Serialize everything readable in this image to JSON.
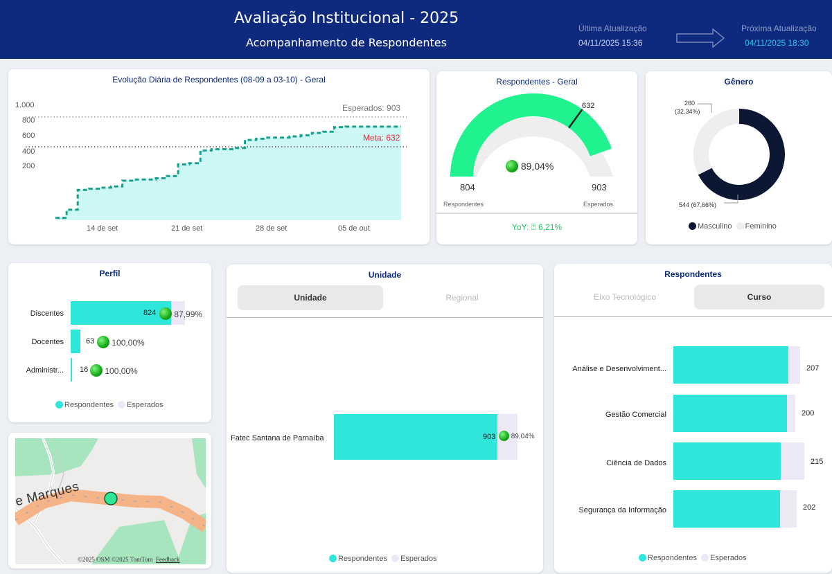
{
  "header": {
    "title": "Avaliação Institucional - 2025",
    "subtitle": "Acompanhamento de Respondentes",
    "last_update_label": "Última Atualização",
    "last_update_value": "04/11/2025 15:36",
    "next_update_label": "Próxima Atualização",
    "next_update_value": "04/11/2025 18:30"
  },
  "daily_chart": {
    "title": "Evolução Diária de Respondentes (08-09 a 03-10) - Geral",
    "expected_label": "Esperados: 903",
    "meta_label": "Meta: 632",
    "y_ticks": [
      "1.000",
      "800",
      "600",
      "400",
      "200"
    ],
    "x_ticks": [
      "14 de set",
      "21 de set",
      "28 de set",
      "05 de out"
    ]
  },
  "chart_data": [
    {
      "type": "area",
      "title": "Evolução Diária de Respondentes (08-09 a 03-10) - Geral",
      "ylim": [
        0,
        1000
      ],
      "x_ticks": [
        "14 de set",
        "21 de set",
        "28 de set",
        "05 de out"
      ],
      "reference_lines": [
        {
          "label": "Esperados",
          "value": 903
        },
        {
          "label": "Meta",
          "value": 632
        }
      ],
      "values": [
        20,
        90,
        260,
        270,
        280,
        290,
        340,
        350,
        350,
        360,
        380,
        480,
        490,
        600,
        610,
        610,
        620,
        690,
        700,
        710,
        710,
        720,
        730,
        750,
        760,
        800,
        804,
        804,
        804,
        804,
        804,
        804
      ]
    },
    {
      "type": "gauge",
      "title": "Respondentes - Geral",
      "value": 804,
      "max": 903,
      "target": 632,
      "percent": "89,04%"
    },
    {
      "type": "pie",
      "title": "Gênero",
      "categories": [
        "Masculino",
        "Feminino"
      ],
      "values": [
        544,
        260
      ],
      "percents": [
        "67,66%",
        "32,34%"
      ]
    },
    {
      "type": "bar",
      "title": "Perfil",
      "categories": [
        "Discentes",
        "Docentes",
        "Administr..."
      ],
      "series": [
        {
          "name": "Respondentes",
          "values": [
            824,
            63,
            16
          ]
        },
        {
          "name": "Esperados",
          "values": [
            936,
            63,
            16
          ]
        }
      ]
    },
    {
      "type": "bar",
      "title": "Unidade",
      "categories": [
        "Fatec Santana de Parnaíba"
      ],
      "series": [
        {
          "name": "Respondentes",
          "values": [
            804
          ]
        },
        {
          "name": "Esperados",
          "values": [
            903
          ]
        }
      ]
    },
    {
      "type": "bar",
      "title": "Respondentes",
      "categories": [
        "Análise e Desenvolviment...",
        "Gestão Comercial",
        "Ciência de Dados",
        "Segurança da Informação"
      ],
      "series": [
        {
          "name": "Esperados",
          "values": [
            207,
            200,
            215,
            202
          ]
        }
      ]
    }
  ],
  "gauge": {
    "title": "Respondentes - Geral",
    "target_value": "632",
    "percent": "89,04%",
    "left_value": "804",
    "right_value": "903",
    "left_label": "Respondentes",
    "right_label": "Esperados",
    "yoy": "YoY: ⍰ 6,21%"
  },
  "gender": {
    "title": "Gênero",
    "fem_label_1": "260",
    "fem_label_2": "(32,34%)",
    "masc_label": "544 (67,66%)",
    "legend_1": "Masculino",
    "legend_2": "Feminino"
  },
  "perfil": {
    "title": "Perfil",
    "rows": [
      {
        "label": "Discentes",
        "value": "824",
        "pct": "87,99%"
      },
      {
        "label": "Docentes",
        "value": "63",
        "pct": "100,00%"
      },
      {
        "label": "Administr...",
        "value": "16",
        "pct": "100,00%"
      }
    ],
    "legend_1": "Respondentes",
    "legend_2": "Esperados"
  },
  "map": {
    "street_label": "e Marques",
    "attribution": "©2025 OSM  ©2025 TomTom",
    "feedback": "Feedback"
  },
  "unidade": {
    "title": "Unidade",
    "tab_1": "Unidade",
    "tab_2": "Regional",
    "row_label": "Fatec Santana de Parnaíba",
    "row_value": "903",
    "row_pct": "89,04%",
    "legend_1": "Respondentes",
    "legend_2": "Esperados"
  },
  "respondentes": {
    "title": "Respondentes",
    "tab_1": "Eixo Tecnológico",
    "tab_2": "Curso",
    "rows": [
      {
        "label": "Análise e Desenvolviment...",
        "value": "207"
      },
      {
        "label": "Gestão Comercial",
        "value": "200"
      },
      {
        "label": "Ciência de Dados",
        "value": "215"
      },
      {
        "label": "Segurança da Informação",
        "value": "202"
      }
    ],
    "legend_1": "Respondentes",
    "legend_2": "Esperados"
  },
  "colors": {
    "header": "#0d2a7e",
    "turquoise": "#2ee6d9",
    "area_fill": "#cdf7f4",
    "line": "#14a38f",
    "gauge_green": "#1ff28f",
    "donut_dark": "#0b1733",
    "light": "#ede8f5",
    "meta_red": "#e0283a"
  }
}
